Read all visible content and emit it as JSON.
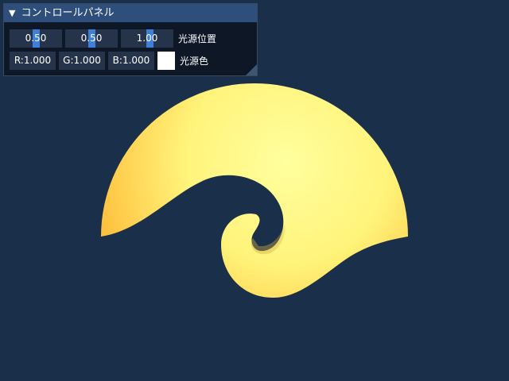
{
  "panel": {
    "title": "コントロールパネル",
    "collapse_icon": "triangle-down-icon",
    "light_position": {
      "label": "光源位置",
      "x": "0.50",
      "y": "0.50",
      "z": "1.00"
    },
    "light_color": {
      "label": "光源色",
      "r": "R:1.000",
      "g": "G:1.000",
      "b": "B:1.000",
      "swatch_color": "#ffffff"
    }
  },
  "scene": {
    "background_color": "#1a2f4a",
    "shape_colors": {
      "highlight": "#ffff9e",
      "base": "#fff37a",
      "shadow": "#ffba35"
    }
  }
}
